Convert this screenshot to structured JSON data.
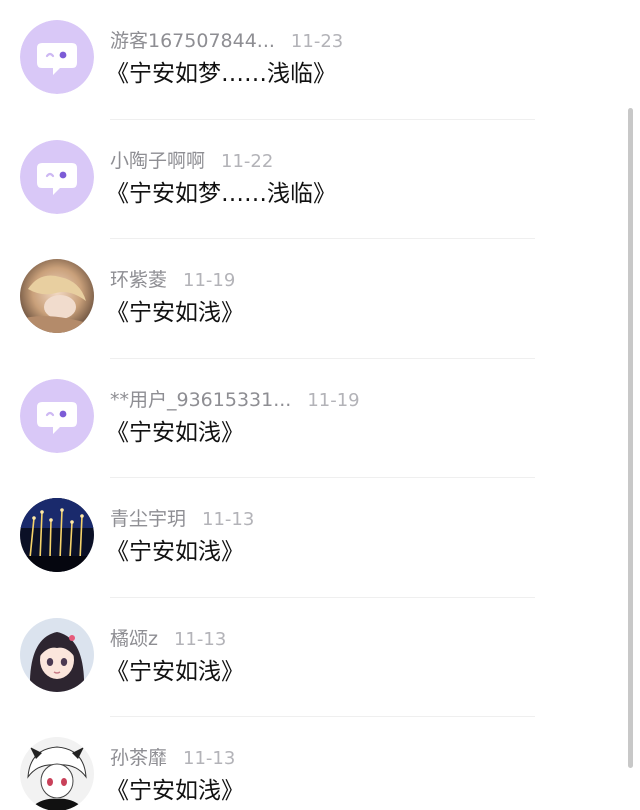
{
  "comments": [
    {
      "avatar_type": "chat-bubble-icon",
      "name": "游客167507844...",
      "time": "11-23",
      "text": "《宁安如梦……浅临》"
    },
    {
      "avatar_type": "chat-bubble-icon",
      "name": "小陶子啊啊",
      "time": "11-22",
      "text": "《宁安如梦……浅临》"
    },
    {
      "avatar_type": "photo-blonde",
      "name": "环紫菱",
      "time": "11-19",
      "text": "《宁安如浅》"
    },
    {
      "avatar_type": "chat-bubble-icon",
      "name": "**用户_93615331...",
      "time": "11-19",
      "text": "《宁安如浅》"
    },
    {
      "avatar_type": "photo-night-lights",
      "name": "青尘宇玥",
      "time": "11-13",
      "text": "《宁安如浅》"
    },
    {
      "avatar_type": "photo-anime-girl",
      "name": "橘颂z",
      "time": "11-13",
      "text": "《宁安如浅》"
    },
    {
      "avatar_type": "photo-bw-anime",
      "name": "孙茶靡",
      "time": "11-13",
      "text": "《宁安如浅》"
    }
  ],
  "colors": {
    "default_avatar_bg": "#d9c8f7",
    "name": "#8e8e93",
    "time": "#b3b3b8",
    "text": "#111111"
  }
}
